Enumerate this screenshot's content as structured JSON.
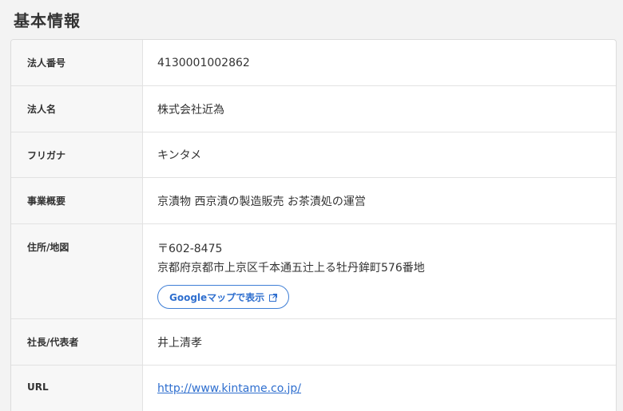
{
  "section": {
    "title": "基本情報"
  },
  "rows": [
    {
      "label": "法人番号",
      "value": "4130001002862"
    },
    {
      "label": "法人名",
      "value": "株式会社近為"
    },
    {
      "label": "フリガナ",
      "value": "キンタメ"
    },
    {
      "label": "事業概要",
      "value": "京漬物 西京漬の製造販売 お茶漬処の運営"
    },
    {
      "label": "住所/地図",
      "postal": "〒602-8475",
      "address": "京都府京都市上京区千本通五辻上る牡丹鉾町576番地",
      "map_button": "Googleマップで表示",
      "map_icon": "external-link-icon"
    },
    {
      "label": "社長/代表者",
      "value": "井上清孝"
    },
    {
      "label": "URL",
      "value": "http://www.kintame.co.jp/"
    }
  ],
  "colors": {
    "accent": "#2f6fcf",
    "label_bg": "#f7f7f7",
    "page_bg": "#f3f3f3"
  }
}
